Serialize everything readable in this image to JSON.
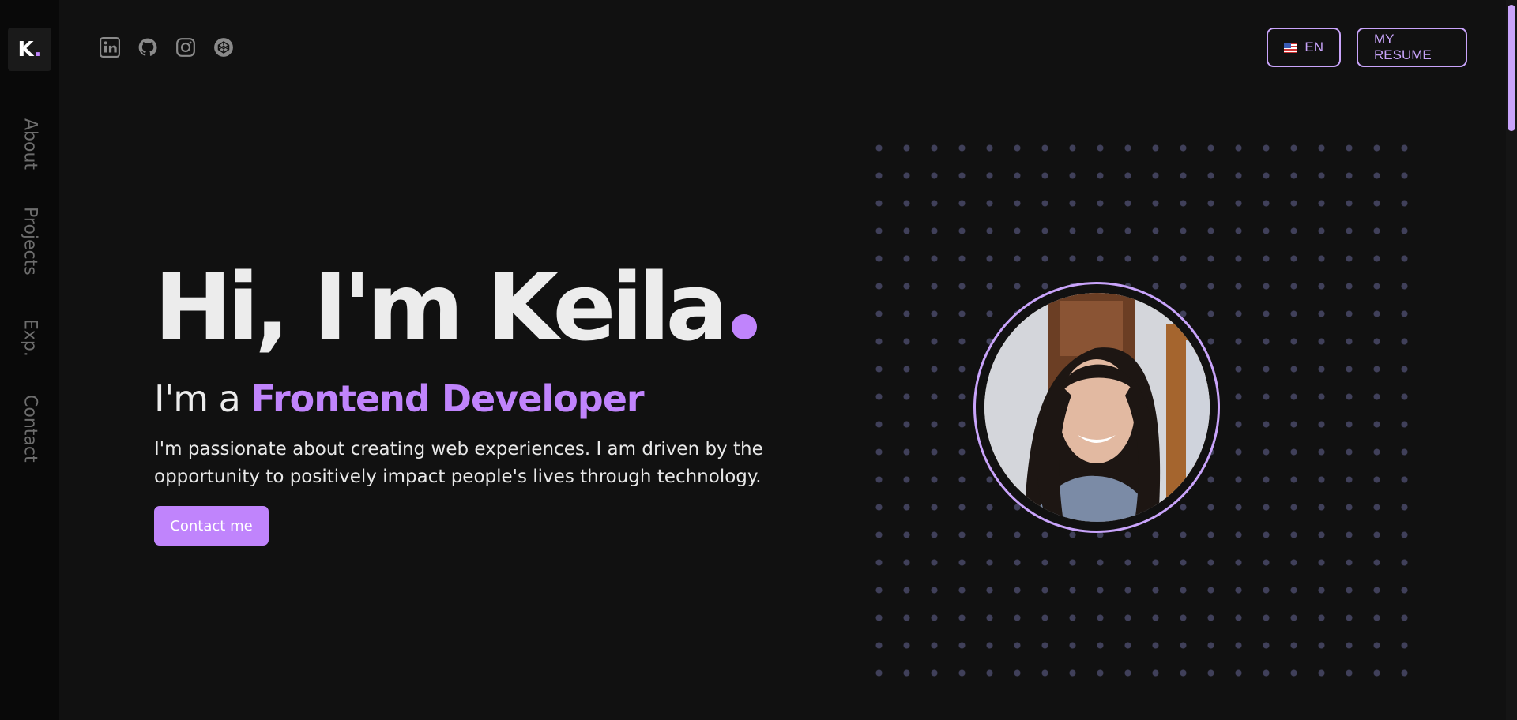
{
  "brand": {
    "letter": "K",
    "dot": "."
  },
  "nav": [
    {
      "label": "About"
    },
    {
      "label": "Projects"
    },
    {
      "label": "Exp."
    },
    {
      "label": "Contact"
    }
  ],
  "socials": [
    {
      "name": "linkedin-icon"
    },
    {
      "name": "github-icon"
    },
    {
      "name": "instagram-icon"
    },
    {
      "name": "codepen-icon"
    }
  ],
  "header": {
    "language_label": "EN",
    "resume_label": "MY RESUME"
  },
  "hero": {
    "title": "Hi, I'm Keila",
    "subtitle_prefix": "I'm a ",
    "role": "Frontend Developer",
    "description": "I'm passionate about creating web experiences. I am driven by the opportunity to positively impact people's lives through technology.",
    "cta_label": "Contact me"
  },
  "colors": {
    "accent": "#c084fc",
    "accent_outline": "#c9a4fb",
    "background": "#111111",
    "sidebar": "#090909"
  }
}
